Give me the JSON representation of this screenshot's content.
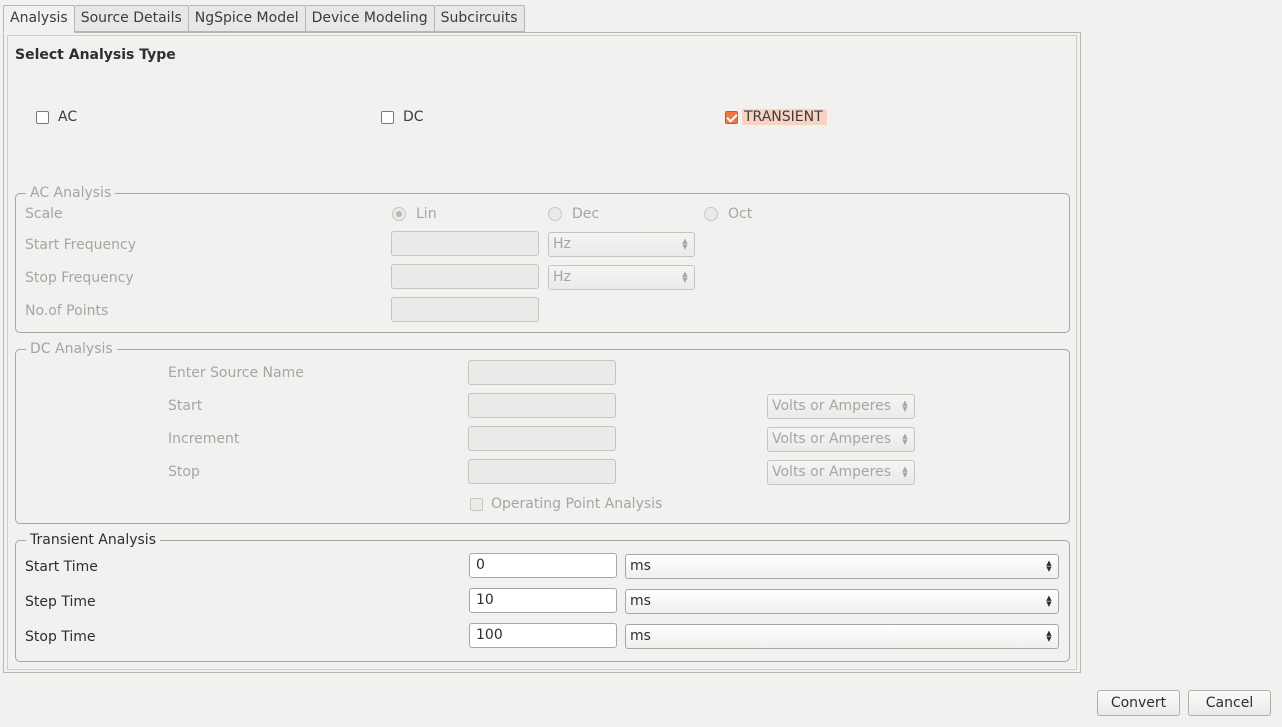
{
  "tabs": [
    "Analysis",
    "Source Details",
    "NgSpice Model",
    "Device Modeling",
    "Subcircuits"
  ],
  "heading": "Select Analysis Type",
  "analysis_types": {
    "ac": {
      "label": "AC",
      "checked": false
    },
    "dc": {
      "label": "DC",
      "checked": false
    },
    "transient": {
      "label": "TRANSIENT",
      "checked": true
    }
  },
  "ac_analysis": {
    "title": "AC Analysis",
    "scale_label": "Scale",
    "scale_options": [
      "Lin",
      "Dec",
      "Oct"
    ],
    "scale_selected": "Lin",
    "start_freq_label": "Start Frequency",
    "start_freq_unit": "Hz",
    "stop_freq_label": "Stop Frequency",
    "stop_freq_unit": "Hz",
    "points_label": "No.of Points"
  },
  "dc_analysis": {
    "title": "DC Analysis",
    "source_label": "Enter Source Name",
    "start_label": "Start",
    "increment_label": "Increment",
    "stop_label": "Stop",
    "unit": "Volts or Amperes",
    "op_label": "Operating Point Analysis"
  },
  "transient_analysis": {
    "title": "Transient Analysis",
    "start_label": "Start Time",
    "start_value": "0",
    "start_unit": "ms",
    "step_label": "Step Time",
    "step_value": "10",
    "step_unit": "ms",
    "stop_label": "Stop Time",
    "stop_value": "100",
    "stop_unit": "ms"
  },
  "buttons": {
    "convert": "Convert",
    "cancel": "Cancel"
  },
  "colors": {
    "accent": "#f07746",
    "highlight": "#f8d3c3"
  }
}
